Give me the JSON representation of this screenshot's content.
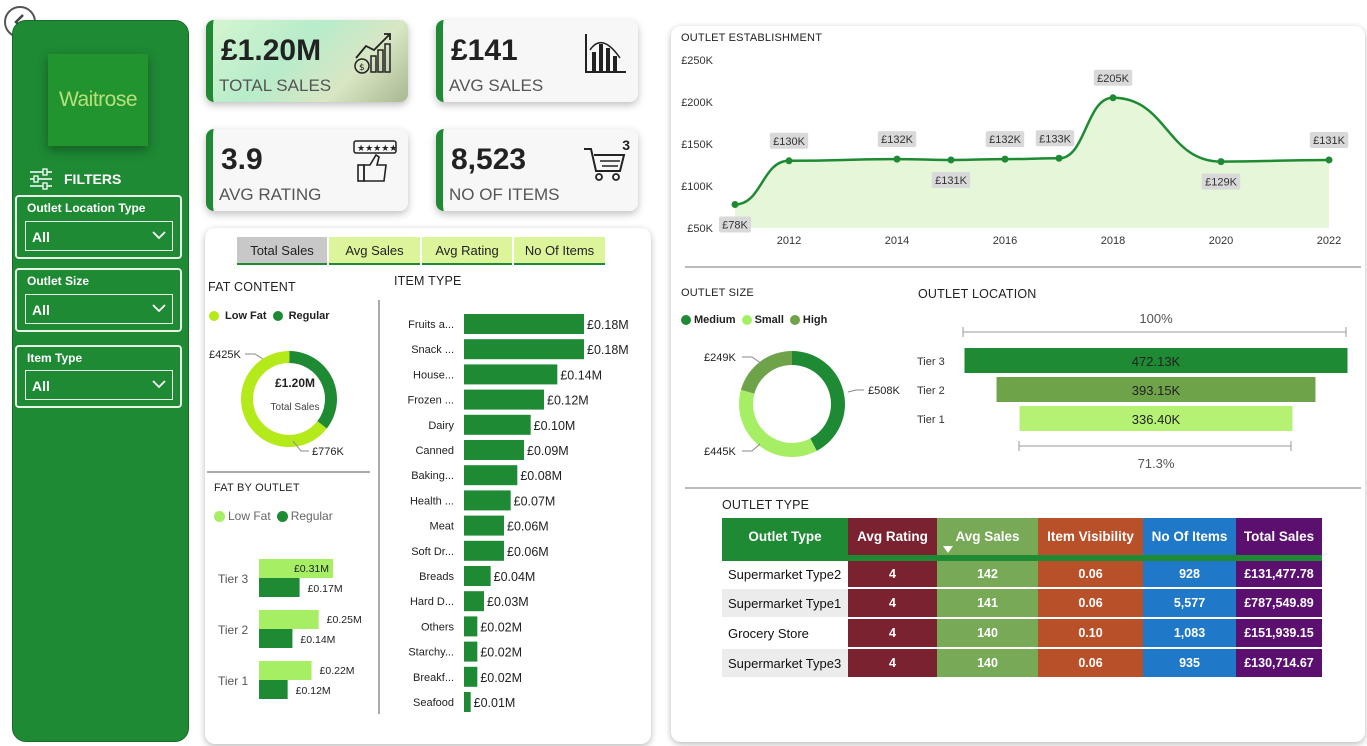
{
  "sidebar": {
    "logo_text": "Waitrose",
    "filters_title": "FILTERS",
    "filters": [
      {
        "label": "Outlet Location Type",
        "value": "All"
      },
      {
        "label": "Outlet Size",
        "value": "All"
      },
      {
        "label": "Item Type",
        "value": "All"
      }
    ]
  },
  "kpis": [
    {
      "value": "£1.20M",
      "label": "TOTAL SALES",
      "icon": "money-growth-icon"
    },
    {
      "value": "£141",
      "label": "AVG SALES",
      "icon": "bar-chart-icon"
    },
    {
      "value": "3.9",
      "label": "AVG RATING",
      "icon": "rating-thumbs-up-icon"
    },
    {
      "value": "8,523",
      "label": "NO OF ITEMS",
      "icon": "shopping-cart-icon",
      "badge": "3"
    }
  ],
  "tabs": [
    "Total Sales",
    "Avg Sales",
    "Avg Rating",
    "No Of Items"
  ],
  "fat_content": {
    "title": "FAT CONTENT",
    "legend": [
      "Low Fat",
      "Regular"
    ],
    "center_value": "£1.20M",
    "center_label": "Total Sales",
    "labels": [
      "£425K",
      "£776K"
    ]
  },
  "fat_by_outlet": {
    "title": "FAT BY OUTLET",
    "legend": [
      "Low Fat",
      "Regular"
    ]
  },
  "item_type_title": "ITEM TYPE",
  "outlet_establishment_title": "OUTLET ESTABLISHMENT",
  "outlet_size": {
    "title": "OUTLET SIZE",
    "legend": [
      "Medium",
      "Small",
      "High"
    ],
    "labels": [
      "£249K",
      "£508K",
      "£445K"
    ]
  },
  "outlet_location": {
    "title": "OUTLET LOCATION",
    "top_pct": "100%",
    "bottom_pct": "71.3%"
  },
  "outlet_type": {
    "title": "OUTLET TYPE",
    "columns": [
      "Outlet Type",
      "Avg Rating",
      "Avg Sales",
      "Item Visibility",
      "No Of Items",
      "Total Sales"
    ],
    "rows": [
      [
        "Supermarket Type2",
        "4",
        "142",
        "0.06",
        "928",
        "£131,477.78"
      ],
      [
        "Supermarket Type1",
        "4",
        "141",
        "0.06",
        "5,577",
        "£787,549.89"
      ],
      [
        "Grocery Store",
        "4",
        "140",
        "0.10",
        "1,083",
        "£151,939.15"
      ],
      [
        "Supermarket Type3",
        "4",
        "140",
        "0.06",
        "935",
        "£130,714.67"
      ]
    ]
  },
  "colors": {
    "brand_green": "#1e8a34",
    "light_green": "#b5ea6c",
    "mid_green": "#6fa34a",
    "avg_rating_col": "#7b2230",
    "avg_sales_col": "#78a957",
    "visibility_col": "#b8512a",
    "items_col": "#1f78c8",
    "total_col": "#5b1070"
  },
  "chart_data": [
    {
      "type": "line",
      "title": "OUTLET ESTABLISHMENT",
      "x": [
        2011,
        2012,
        2014,
        2015,
        2016,
        2017,
        2018,
        2020,
        2022
      ],
      "values": [
        78,
        130,
        132,
        131,
        132,
        133,
        205,
        129,
        131
      ],
      "value_labels": [
        "£78K",
        "£130K",
        "£132K",
        "£131K",
        "£132K",
        "£133K",
        "£205K",
        "£129K",
        "£131K"
      ],
      "x_ticks": [
        "2012",
        "2014",
        "2016",
        "2018",
        "2020",
        "2022"
      ],
      "y_ticks": [
        "£50K",
        "£100K",
        "£150K",
        "£200K",
        "£250K"
      ],
      "ylim": [
        50,
        250
      ],
      "xlim": [
        2011,
        2022
      ],
      "grid": false
    },
    {
      "type": "bar",
      "title": "ITEM TYPE",
      "orientation": "horizontal",
      "categories": [
        "Fruits a...",
        "Snack ...",
        "House...",
        "Frozen ...",
        "Dairy",
        "Canned",
        "Baking...",
        "Health ...",
        "Meat",
        "Soft Dr...",
        "Breads",
        "Hard D...",
        "Others",
        "Starchy...",
        "Breakf...",
        "Seafood"
      ],
      "values": [
        0.18,
        0.18,
        0.14,
        0.12,
        0.1,
        0.09,
        0.08,
        0.07,
        0.06,
        0.06,
        0.04,
        0.03,
        0.02,
        0.02,
        0.02,
        0.01
      ],
      "value_labels": [
        "£0.18M",
        "£0.18M",
        "£0.14M",
        "£0.12M",
        "£0.10M",
        "£0.09M",
        "£0.08M",
        "£0.07M",
        "£0.06M",
        "£0.06M",
        "£0.04M",
        "£0.03M",
        "£0.02M",
        "£0.02M",
        "£0.02M",
        "£0.01M"
      ]
    },
    {
      "type": "pie",
      "title": "FAT CONTENT",
      "categories": [
        "Low Fat",
        "Regular"
      ],
      "values": [
        776,
        425
      ]
    },
    {
      "type": "bar",
      "title": "FAT BY OUTLET",
      "orientation": "horizontal",
      "categories": [
        "Tier 3",
        "Tier 2",
        "Tier 1"
      ],
      "series": [
        {
          "name": "Low Fat",
          "values": [
            0.31,
            0.25,
            0.22
          ],
          "value_labels": [
            "£0.31M",
            "£0.25M",
            "£0.22M"
          ]
        },
        {
          "name": "Regular",
          "values": [
            0.17,
            0.14,
            0.12
          ],
          "value_labels": [
            "£0.17M",
            "£0.14M",
            "£0.12M"
          ]
        }
      ]
    },
    {
      "type": "pie",
      "title": "OUTLET SIZE",
      "categories": [
        "Medium",
        "Small",
        "High"
      ],
      "values": [
        508,
        445,
        249
      ]
    },
    {
      "type": "bar",
      "title": "OUTLET LOCATION",
      "orientation": "horizontal",
      "categories": [
        "Tier 3",
        "Tier 2",
        "Tier 1"
      ],
      "values": [
        472.13,
        393.15,
        336.4
      ],
      "value_labels": [
        "472.13K",
        "393.15K",
        "336.40K"
      ]
    }
  ]
}
